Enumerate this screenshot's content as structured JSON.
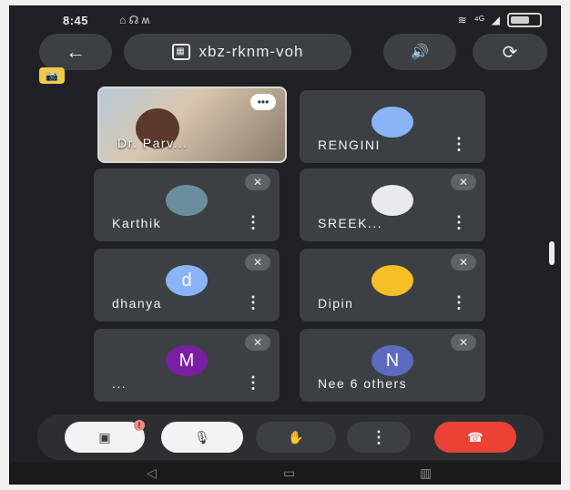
{
  "status": {
    "time": "8:45",
    "notifications": "⌂ ☊ ʍ",
    "wifi": "≋",
    "signal": "◢",
    "network": "⁴ᴳ"
  },
  "topbar": {
    "back_icon": "←",
    "meeting_code": "xbz-rknm-voh",
    "speaker_icon": "🔊",
    "switch_icon": "⟳",
    "camera_off_icon": "📷"
  },
  "participants": [
    {
      "name": "Dr. Parv...",
      "type": "video"
    },
    {
      "name": "RENGINI",
      "avatar": "photo",
      "color": "#8ab4f8"
    },
    {
      "name": "Karthik",
      "avatar": "photo",
      "color": "#6b8e9e",
      "muted": true
    },
    {
      "name": "SREEK...",
      "avatar": "photo",
      "color": "#e8eaed",
      "muted": true
    },
    {
      "name": "dhanya",
      "initial": "d",
      "color": "#8ab4f8",
      "muted": true
    },
    {
      "name": "Dipin",
      "avatar": "photo",
      "color": "#f6bf26",
      "muted": true
    },
    {
      "name": "...",
      "initial": "M",
      "color": "#7b1fa2",
      "muted": true
    },
    {
      "name": "Nee   6 others",
      "initial": "N",
      "color": "#5c6bc0",
      "muted": true
    }
  ],
  "controls": {
    "camera_icon": "▣",
    "alert": "!",
    "mic_icon": "🎙",
    "raise_hand_icon": "✋",
    "more_icon": "⋮",
    "end_call_icon": "☎"
  },
  "navbar": {
    "back": "◁",
    "home": "▭",
    "recents": "▥"
  },
  "tile_icons": {
    "more": "⋮",
    "mute": "🎙",
    "talking": "•••"
  }
}
